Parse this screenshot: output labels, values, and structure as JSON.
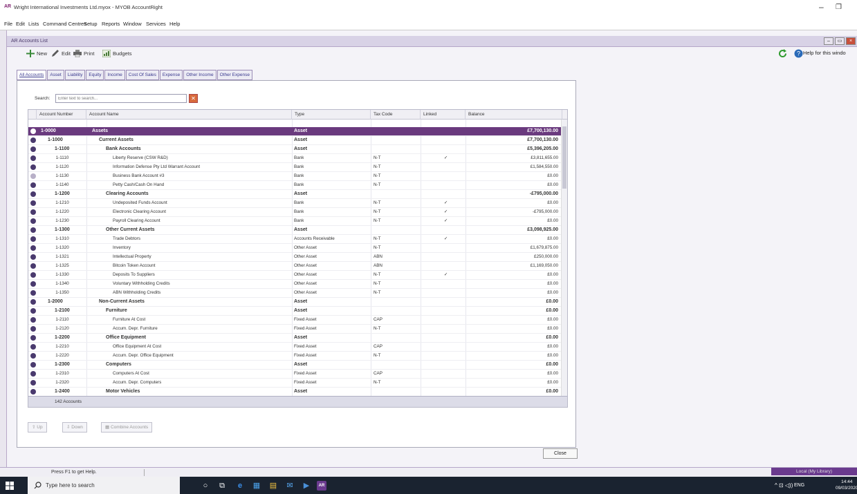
{
  "app": {
    "logo": "AR",
    "title": "Wright International Investments Ltd.myox - MYOB AccountRight"
  },
  "menu": [
    "File",
    "Edit",
    "Lists",
    "Command Centres",
    "Setup",
    "Reports",
    "Window",
    "Services",
    "Help"
  ],
  "window": {
    "title": "AR Accounts List",
    "help_label": "Help for this windo"
  },
  "toolbar": {
    "new_label": "New",
    "edit_label": "Edit",
    "print_label": "Print",
    "budgets_label": "Budgets"
  },
  "tabs": [
    "All Accounts",
    "Asset",
    "Liability",
    "Equity",
    "Income",
    "Cost Of Sales",
    "Expense",
    "Other Income",
    "Other Expense"
  ],
  "search": {
    "label": "Search:",
    "placeholder": "Enter text to search..."
  },
  "columns": {
    "number": "Account Number",
    "name": "Account Name",
    "type": "Type",
    "tax": "Tax Code",
    "linked": "Linked",
    "balance": "Balance"
  },
  "chart_data": {
    "type": "table",
    "rows": [
      {
        "number": "1-0000",
        "name": "Assets",
        "type": "Asset",
        "tax": "",
        "linked": "",
        "balance": "£7,700,130.00",
        "level": 0,
        "header": true,
        "selected": true
      },
      {
        "number": "1-1000",
        "name": "Current Assets",
        "type": "Asset",
        "tax": "",
        "linked": "",
        "balance": "£7,700,130.00",
        "level": 1,
        "header": true
      },
      {
        "number": "1-1100",
        "name": "Bank Accounts",
        "type": "Asset",
        "tax": "",
        "linked": "",
        "balance": "£5,396,205.00",
        "level": 2,
        "header": true
      },
      {
        "number": "1-1110",
        "name": "Liberty Reserve (CSW R&D)",
        "type": "Bank",
        "tax": "N-T",
        "linked": "✓",
        "balance": "£3,811,655.00",
        "level": 3
      },
      {
        "number": "1-1120",
        "name": "Information Defense Pty Ltd Warrant Account",
        "type": "Bank",
        "tax": "N-T",
        "linked": "",
        "balance": "£1,584,550.00",
        "level": 3
      },
      {
        "number": "1-1130",
        "name": "Business Bank Account #3",
        "type": "Bank",
        "tax": "N-T",
        "linked": "",
        "balance": "£0.00",
        "level": 3,
        "light": true
      },
      {
        "number": "1-1140",
        "name": "Petty Cash/Cash On Hand",
        "type": "Bank",
        "tax": "N-T",
        "linked": "",
        "balance": "£0.00",
        "level": 3
      },
      {
        "number": "1-1200",
        "name": "Clearing Accounts",
        "type": "Asset",
        "tax": "",
        "linked": "",
        "balance": "-£795,000.00",
        "level": 2,
        "header": true
      },
      {
        "number": "1-1210",
        "name": "Undeposited Funds Account",
        "type": "Bank",
        "tax": "N-T",
        "linked": "✓",
        "balance": "£0.00",
        "level": 3
      },
      {
        "number": "1-1220",
        "name": "Electronic Clearing Account",
        "type": "Bank",
        "tax": "N-T",
        "linked": "✓",
        "balance": "-£795,000.00",
        "level": 3
      },
      {
        "number": "1-1230",
        "name": "Payroll Clearing Account",
        "type": "Bank",
        "tax": "N-T",
        "linked": "✓",
        "balance": "£0.00",
        "level": 3
      },
      {
        "number": "1-1300",
        "name": "Other Current Assets",
        "type": "Asset",
        "tax": "",
        "linked": "",
        "balance": "£3,098,925.00",
        "level": 2,
        "header": true
      },
      {
        "number": "1-1310",
        "name": "Trade Debtors",
        "type": "Accounts Receivable",
        "tax": "N-T",
        "linked": "✓",
        "balance": "£0.00",
        "level": 3
      },
      {
        "number": "1-1320",
        "name": "Inventory",
        "type": "Other Asset",
        "tax": "N-T",
        "linked": "",
        "balance": "£1,679,875.00",
        "level": 3
      },
      {
        "number": "1-1321",
        "name": "Intellectual Property",
        "type": "Other Asset",
        "tax": "ABN",
        "linked": "",
        "balance": "£250,000.00",
        "level": 3
      },
      {
        "number": "1-1325",
        "name": "Bitcoin Token Account",
        "type": "Other Asset",
        "tax": "ABN",
        "linked": "",
        "balance": "£1,169,050.00",
        "level": 3
      },
      {
        "number": "1-1330",
        "name": "Deposits To Suppliers",
        "type": "Other Asset",
        "tax": "N-T",
        "linked": "✓",
        "balance": "£0.00",
        "level": 3
      },
      {
        "number": "1-1340",
        "name": "Voluntary Withholding Credits",
        "type": "Other Asset",
        "tax": "N-T",
        "linked": "",
        "balance": "£0.00",
        "level": 3
      },
      {
        "number": "1-1350",
        "name": "ABN Withholding Credits",
        "type": "Other Asset",
        "tax": "N-T",
        "linked": "",
        "balance": "£0.00",
        "level": 3
      },
      {
        "number": "1-2000",
        "name": "Non-Current Assets",
        "type": "Asset",
        "tax": "",
        "linked": "",
        "balance": "£0.00",
        "level": 1,
        "header": true
      },
      {
        "number": "1-2100",
        "name": "Furniture",
        "type": "Asset",
        "tax": "",
        "linked": "",
        "balance": "£0.00",
        "level": 2,
        "header": true
      },
      {
        "number": "1-2110",
        "name": "Furniture At Cost",
        "type": "Fixed Asset",
        "tax": "CAP",
        "linked": "",
        "balance": "£0.00",
        "level": 3
      },
      {
        "number": "1-2120",
        "name": "Accum. Depr. Furniture",
        "type": "Fixed Asset",
        "tax": "N-T",
        "linked": "",
        "balance": "£0.00",
        "level": 3
      },
      {
        "number": "1-2200",
        "name": "Office Equipment",
        "type": "Asset",
        "tax": "",
        "linked": "",
        "balance": "£0.00",
        "level": 2,
        "header": true
      },
      {
        "number": "1-2210",
        "name": "Office Equipment At Cost",
        "type": "Fixed Asset",
        "tax": "CAP",
        "linked": "",
        "balance": "£0.00",
        "level": 3
      },
      {
        "number": "1-2220",
        "name": "Accum. Depr. Office Equipment",
        "type": "Fixed Asset",
        "tax": "N-T",
        "linked": "",
        "balance": "£0.00",
        "level": 3
      },
      {
        "number": "1-2300",
        "name": "Computers",
        "type": "Asset",
        "tax": "",
        "linked": "",
        "balance": "£0.00",
        "level": 2,
        "header": true
      },
      {
        "number": "1-2310",
        "name": "Computers At Cost",
        "type": "Fixed Asset",
        "tax": "CAP",
        "linked": "",
        "balance": "£0.00",
        "level": 3
      },
      {
        "number": "1-2320",
        "name": "Accum. Depr. Computers",
        "type": "Fixed Asset",
        "tax": "N-T",
        "linked": "",
        "balance": "£0.00",
        "level": 3
      },
      {
        "number": "1-2400",
        "name": "Motor Vehicles",
        "type": "Asset",
        "tax": "",
        "linked": "",
        "balance": "£0.00",
        "level": 2,
        "header": true
      }
    ]
  },
  "count_label": "142 Accounts",
  "buttons": {
    "up": "Up",
    "down": "Down",
    "combine": "Combine Accounts",
    "close": "Close"
  },
  "status": {
    "hint": "Press F1 to get Help.",
    "library": "Local (My Library)"
  },
  "taskbar": {
    "search_placeholder": "Type here to search",
    "lang": "ENG",
    "time": "14:44",
    "date": "09/03/2020",
    "app_badge": "AR"
  },
  "colors": {
    "accent": "#6a3a7e",
    "title_purple": "#d8d2e6",
    "taskbar": "#1a2330"
  }
}
